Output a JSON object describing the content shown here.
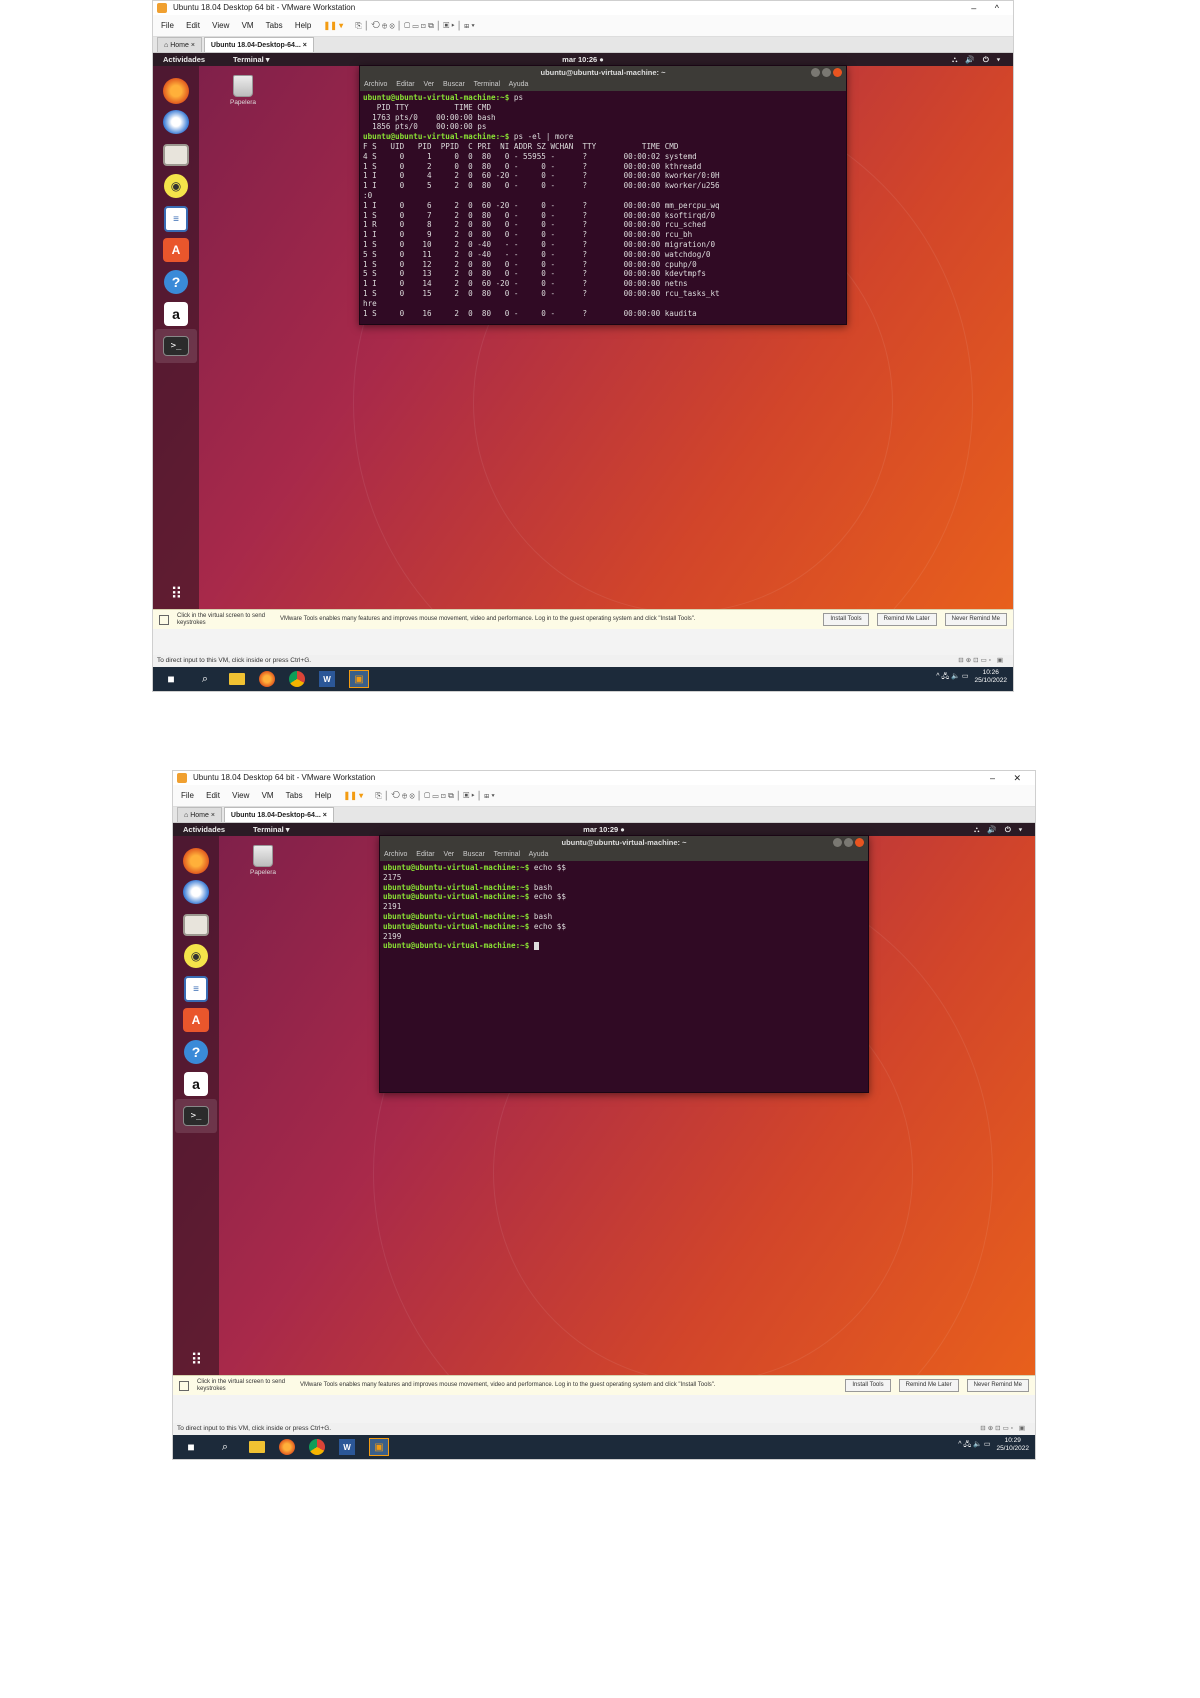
{
  "shot1": {
    "vm": {
      "title": "Ubuntu 18.04 Desktop 64 bit - VMware Workstation",
      "window_controls": "– ^",
      "menu": [
        "File",
        "Edit",
        "View",
        "VM",
        "Tabs",
        "Help"
      ],
      "tabs": [
        "Home",
        "Ubuntu 18.04-Desktop-64..."
      ]
    },
    "topbar": {
      "activities": "Actividades",
      "app": "Terminal ▾",
      "clock": "mar 10:26 ●",
      "system": "⛬ 🔊 ⏻ ▾"
    },
    "trash_label": "Papelera",
    "terminal": {
      "title": "ubuntu@ubuntu-virtual-machine: ~",
      "menu": [
        "Archivo",
        "Editar",
        "Ver",
        "Buscar",
        "Terminal",
        "Ayuda"
      ],
      "lines": [
        {
          "prompt": "ubuntu@ubuntu-virtual-machine:~$",
          "text": " ps"
        },
        {
          "prompt": "",
          "text": "   PID TTY          TIME CMD"
        },
        {
          "prompt": "",
          "text": "  1763 pts/0    00:00:00 bash"
        },
        {
          "prompt": "",
          "text": "  1856 pts/0    00:00:00 ps"
        },
        {
          "prompt": "ubuntu@ubuntu-virtual-machine:~$",
          "text": " ps -el | more"
        },
        {
          "prompt": "",
          "text": "F S   UID   PID  PPID  C PRI  NI ADDR SZ WCHAN  TTY          TIME CMD"
        },
        {
          "prompt": "",
          "text": "4 S     0     1     0  0  80   0 - 55955 -      ?        00:00:02 systemd"
        },
        {
          "prompt": "",
          "text": "1 S     0     2     0  0  80   0 -     0 -      ?        00:00:00 kthreadd"
        },
        {
          "prompt": "",
          "text": "1 I     0     4     2  0  60 -20 -     0 -      ?        00:00:00 kworker/0:0H"
        },
        {
          "prompt": "",
          "text": "1 I     0     5     2  0  80   0 -     0 -      ?        00:00:00 kworker/u256"
        },
        {
          "prompt": "",
          "text": ":0"
        },
        {
          "prompt": "",
          "text": "1 I     0     6     2  0  60 -20 -     0 -      ?        00:00:00 mm_percpu_wq"
        },
        {
          "prompt": "",
          "text": "1 S     0     7     2  0  80   0 -     0 -      ?        00:00:00 ksoftirqd/0"
        },
        {
          "prompt": "",
          "text": "1 R     0     8     2  0  80   0 -     0 -      ?        00:00:00 rcu_sched"
        },
        {
          "prompt": "",
          "text": "1 I     0     9     2  0  80   0 -     0 -      ?        00:00:00 rcu_bh"
        },
        {
          "prompt": "",
          "text": "1 S     0    10     2  0 -40   - -     0 -      ?        00:00:00 migration/0"
        },
        {
          "prompt": "",
          "text": "5 S     0    11     2  0 -40   - -     0 -      ?        00:00:00 watchdog/0"
        },
        {
          "prompt": "",
          "text": "1 S     0    12     2  0  80   0 -     0 -      ?        00:00:00 cpuhp/0"
        },
        {
          "prompt": "",
          "text": "5 S     0    13     2  0  80   0 -     0 -      ?        00:00:00 kdevtmpfs"
        },
        {
          "prompt": "",
          "text": "1 I     0    14     2  0  60 -20 -     0 -      ?        00:00:00 netns"
        },
        {
          "prompt": "",
          "text": "1 S     0    15     2  0  80   0 -     0 -      ?        00:00:00 rcu_tasks_kt"
        },
        {
          "prompt": "",
          "text": "hre"
        },
        {
          "prompt": "",
          "text": "1 S     0    16     2  0  80   0 -     0 -      ?        00:00:00 kaudita"
        }
      ]
    },
    "notice": {
      "left": "Click in the virtual screen to send keystrokes",
      "message": "VMware Tools enables many features and improves mouse movement, video and performance. Log in to the guest operating system and click \"Install Tools\".",
      "buttons": [
        "Install Tools",
        "Remind Me Later",
        "Never Remind Me"
      ]
    },
    "status": "To direct input to this VM, click inside or press Ctrl+G.",
    "tray": {
      "arrows": "^ 🖧 🔈 ▭",
      "time": "10:26",
      "date": "25/10/2022"
    }
  },
  "shot2": {
    "vm": {
      "title": "Ubuntu 18.04 Desktop 64 bit - VMware Workstation",
      "window_controls": "– ✕",
      "menu": [
        "File",
        "Edit",
        "View",
        "VM",
        "Tabs",
        "Help"
      ],
      "tabs": [
        "Home",
        "Ubuntu 18.04-Desktop-64..."
      ]
    },
    "topbar": {
      "activities": "Actividades",
      "app": "Terminal ▾",
      "clock": "mar 10:29 ●",
      "system": "⛬ 🔊 ⏻ ▾"
    },
    "trash_label": "Papelera",
    "terminal": {
      "title": "ubuntu@ubuntu-virtual-machine: ~",
      "menu": [
        "Archivo",
        "Editar",
        "Ver",
        "Buscar",
        "Terminal",
        "Ayuda"
      ],
      "lines": [
        {
          "prompt": "ubuntu@ubuntu-virtual-machine:~$",
          "text": " echo $$"
        },
        {
          "prompt": "",
          "text": "2175"
        },
        {
          "prompt": "ubuntu@ubuntu-virtual-machine:~$",
          "text": " bash"
        },
        {
          "prompt": "ubuntu@ubuntu-virtual-machine:~$",
          "text": " echo $$"
        },
        {
          "prompt": "",
          "text": "2191"
        },
        {
          "prompt": "ubuntu@ubuntu-virtual-machine:~$",
          "text": " bash"
        },
        {
          "prompt": "ubuntu@ubuntu-virtual-machine:~$",
          "text": " echo $$"
        },
        {
          "prompt": "",
          "text": "2199"
        },
        {
          "prompt": "ubuntu@ubuntu-virtual-machine:~$",
          "text": " ",
          "cursor": true
        }
      ]
    },
    "notice": {
      "left": "Click in the virtual screen to send keystrokes",
      "message": "VMware Tools enables many features and improves mouse movement, video and performance. Log in to the guest operating system and click \"Install Tools\".",
      "buttons": [
        "Install Tools",
        "Remind Me Later",
        "Never Remind Me"
      ]
    },
    "status": "To direct input to this VM, click inside or press Ctrl+G.",
    "tray": {
      "arrows": "^ 🖧 🔈 ▭",
      "time": "10:29",
      "date": "25/10/2022"
    }
  }
}
